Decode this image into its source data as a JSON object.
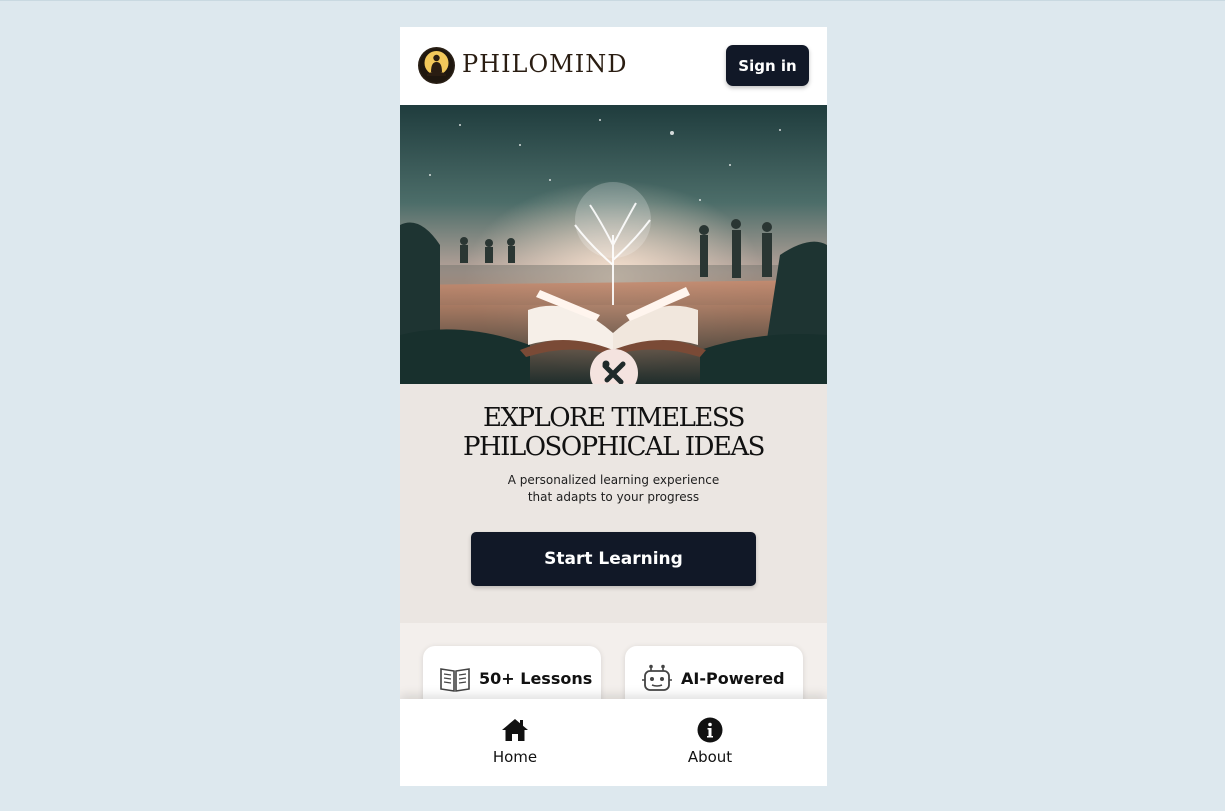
{
  "brand": {
    "name": "PHILOMIND",
    "logo_icon": "meditating-figure-icon"
  },
  "header": {
    "signin_label": "Sign in"
  },
  "hero": {
    "image_name": "open-book-tree-hero-image",
    "emblem_icon": "crossed-tools-icon"
  },
  "intro": {
    "headline_line1": "EXPLORE TIMELESS",
    "headline_line2": "PHILOSOPHICAL IDEAS",
    "subline_line1": "A personalized learning experience",
    "subline_line2": "that adapts to your progress",
    "cta_label": "Start Learning"
  },
  "features": [
    {
      "icon": "book-icon",
      "label": "50+ Lessons"
    },
    {
      "icon": "robot-icon",
      "label": "AI-Powered"
    }
  ],
  "nav": [
    {
      "icon": "home-icon",
      "label": "Home"
    },
    {
      "icon": "info-icon",
      "label": "About"
    }
  ],
  "colors": {
    "page_background": "#dde8ee",
    "button_dark": "#111827",
    "intro_background": "#ebe6e2",
    "features_background": "#f3efec"
  }
}
